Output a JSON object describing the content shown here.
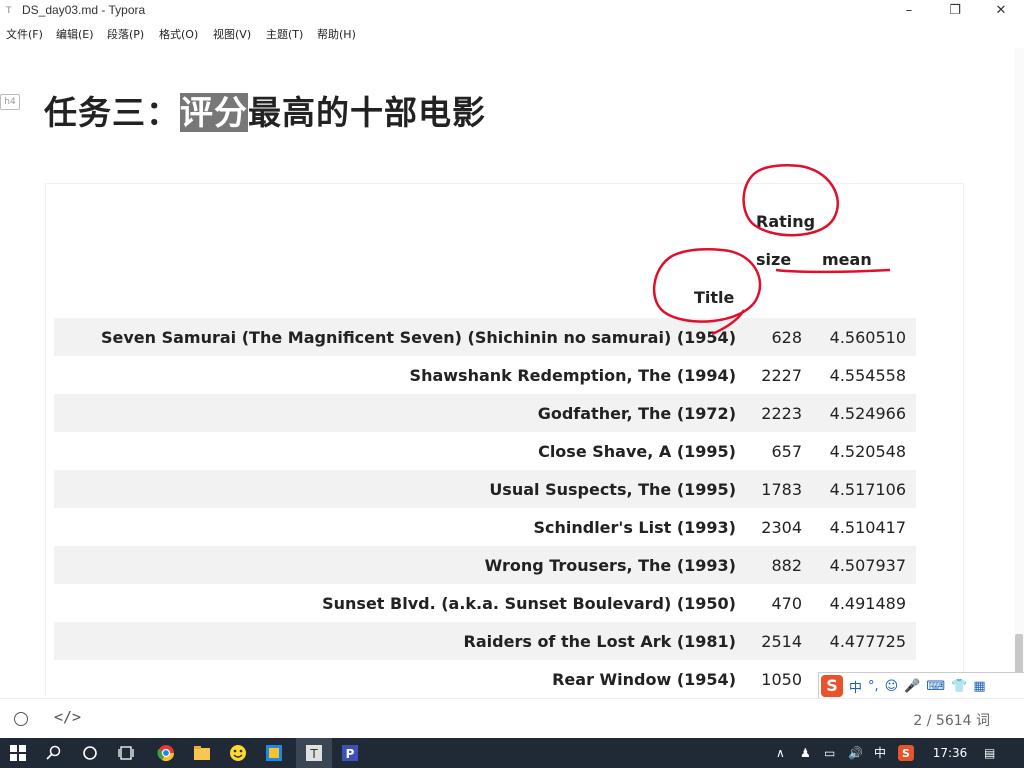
{
  "window": {
    "title": "DS_day03.md - Typora",
    "minimize": "–",
    "maximize": "❐",
    "close": "✕"
  },
  "menu": [
    {
      "label": "文件(F)"
    },
    {
      "label": "编辑(E)"
    },
    {
      "label": "段落(P)"
    },
    {
      "label": "格式(O)"
    },
    {
      "label": "视图(V)"
    },
    {
      "label": "主题(T)"
    },
    {
      "label": "帮助(H)"
    }
  ],
  "doc": {
    "heading_badge": "h4",
    "heading_pre": "任务三：",
    "heading_highlight": "评分",
    "heading_post": "最高的十部电影"
  },
  "table": {
    "header_rating": "Rating",
    "header_size": "size",
    "header_mean": "mean",
    "header_title": "Title",
    "rows": [
      {
        "title": "Seven Samurai (The Magnificent Seven) (Shichinin no samurai) (1954)",
        "size": "628",
        "mean": "4.560510"
      },
      {
        "title": "Shawshank Redemption, The (1994)",
        "size": "2227",
        "mean": "4.554558"
      },
      {
        "title": "Godfather, The (1972)",
        "size": "2223",
        "mean": "4.524966"
      },
      {
        "title": "Close Shave, A (1995)",
        "size": "657",
        "mean": "4.520548"
      },
      {
        "title": "Usual Suspects, The (1995)",
        "size": "1783",
        "mean": "4.517106"
      },
      {
        "title": "Schindler's List (1993)",
        "size": "2304",
        "mean": "4.510417"
      },
      {
        "title": "Wrong Trousers, The (1993)",
        "size": "882",
        "mean": "4.507937"
      },
      {
        "title": "Sunset Blvd. (a.k.a. Sunset Boulevard) (1950)",
        "size": "470",
        "mean": "4.491489"
      },
      {
        "title": "Raiders of the Lost Ark (1981)",
        "size": "2514",
        "mean": "4.477725"
      },
      {
        "title": "Rear Window (1954)",
        "size": "1050",
        "mean": ""
      }
    ]
  },
  "ime": {
    "logo": "S",
    "lang": "中",
    "punct": "°,"
  },
  "status": {
    "code_toggle": "</>",
    "word_count": "2 / 5614 词"
  },
  "taskbar": {
    "ime_lang": "中",
    "time": "17:36"
  },
  "colors": {
    "annotation_red": "#e0102a",
    "taskbar": "#1f2a36",
    "ime_logo": "#e8532b"
  }
}
